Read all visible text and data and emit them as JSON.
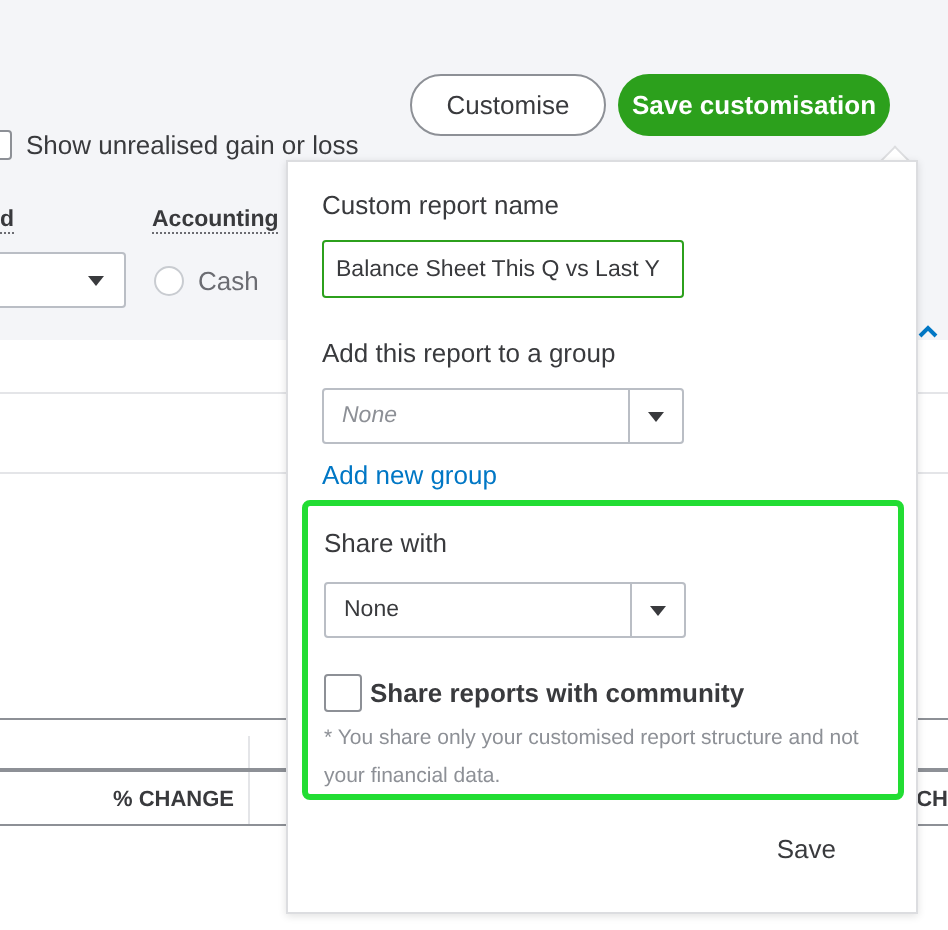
{
  "toolbar": {
    "buttons": [
      {
        "label": "Customise",
        "kind": "outline"
      },
      {
        "label": "Save customisation",
        "kind": "primary"
      }
    ]
  },
  "options": {
    "unrealised_gain": {
      "label": "Show unrealised gain or loss",
      "checked": false
    },
    "period_label": "d",
    "accounting_method": {
      "label": "Accounting",
      "choices": [
        {
          "label": "Cash",
          "selected": false
        }
      ]
    }
  },
  "table": {
    "columns": [
      {
        "label": "% CHANGE"
      },
      {
        "label": "CH"
      }
    ]
  },
  "popover": {
    "report_name": {
      "label": "Custom report name",
      "value": "Balance Sheet This Q vs Last Y"
    },
    "group": {
      "label": "Add this report to a group",
      "placeholder": "None",
      "link": "Add new group"
    },
    "share": {
      "label": "Share with",
      "value": "None",
      "community": {
        "label": "Share reports with community",
        "checked": false
      },
      "note": "* You share only your customised report structure and not your financial data."
    },
    "save": "Save"
  }
}
